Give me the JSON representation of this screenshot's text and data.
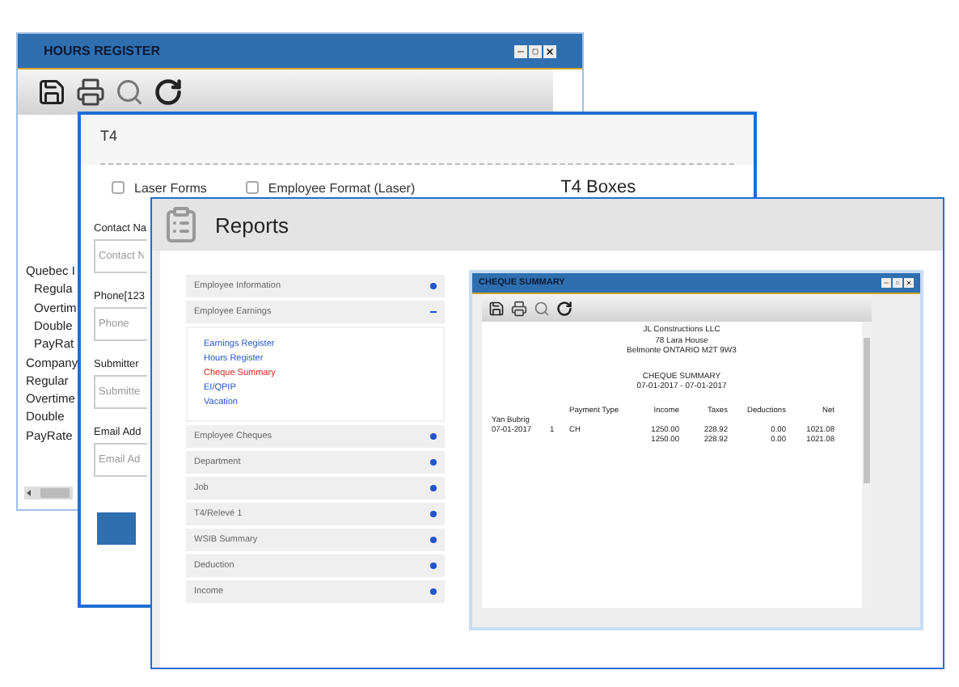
{
  "hours_register": {
    "title": "HOURS REGISTER",
    "lines": [
      {
        "text": "Quebec I",
        "indented": false
      },
      {
        "text": "Regula",
        "indented": true
      },
      {
        "text": "Overtim",
        "indented": true
      },
      {
        "text": "Double",
        "indented": true
      },
      {
        "text": "PayRat",
        "indented": true
      },
      {
        "text": "Company",
        "indented": false
      },
      {
        "text": "Regular",
        "indented": false
      },
      {
        "text": "Overtime",
        "indented": false
      },
      {
        "text": "Double",
        "indented": false
      },
      {
        "text": "PayRate",
        "indented": false
      }
    ]
  },
  "t4": {
    "title": "T4",
    "options": [
      {
        "label": "Laser Forms",
        "checked": false
      },
      {
        "label": "Employee Format (Laser)",
        "checked": false
      }
    ],
    "heading": "T4 Boxes",
    "fields": [
      {
        "label": "Contact Na",
        "placeholder": "Contact N"
      },
      {
        "label": "Phone[123",
        "placeholder": "Phone"
      },
      {
        "label": "Submitter",
        "placeholder": "Submitte"
      },
      {
        "label": "Email Add",
        "placeholder": "Email Ad"
      }
    ]
  },
  "reports": {
    "title": "Reports",
    "sections": [
      {
        "label": "Employee Information",
        "expanded": false
      },
      {
        "label": "Employee Earnings",
        "expanded": true,
        "items": [
          {
            "label": "Earnings Register",
            "selected": false
          },
          {
            "label": "Hours Register",
            "selected": false
          },
          {
            "label": "Cheque Summary",
            "selected": true
          },
          {
            "label": "EI/QPIP",
            "selected": false
          },
          {
            "label": "Vacation",
            "selected": false
          }
        ]
      },
      {
        "label": "Employee Cheques",
        "expanded": false
      },
      {
        "label": "Department",
        "expanded": false
      },
      {
        "label": "Job",
        "expanded": false
      },
      {
        "label": "T4/Relevé 1",
        "expanded": false
      },
      {
        "label": "WSIB Summary",
        "expanded": false
      },
      {
        "label": "Deduction",
        "expanded": false
      },
      {
        "label": "Income",
        "expanded": false
      }
    ]
  },
  "cheque_summary": {
    "title": "CHEQUE SUMMARY",
    "report": {
      "company_lines": [
        "JL Constructions LLC",
        "78 Lara House",
        "Belmonte ONTARIO M2T 9W3"
      ],
      "title": "CHEQUE SUMMARY",
      "period": "07-01-2017 - 07-01-2017",
      "columns": [
        "Payment Type",
        "Income",
        "Taxes",
        "Deductions",
        "Net"
      ],
      "employee": "Yan Bubrig",
      "rows": [
        {
          "date": "07-01-2017",
          "number": "1",
          "payment_type": "CH",
          "income": "1250.00",
          "taxes": "228.92",
          "deductions": "0.00",
          "net": "1021.08"
        }
      ],
      "totals": {
        "income": "1250.00",
        "taxes": "228.92",
        "deductions": "0.00",
        "net": "1021.08"
      }
    }
  }
}
